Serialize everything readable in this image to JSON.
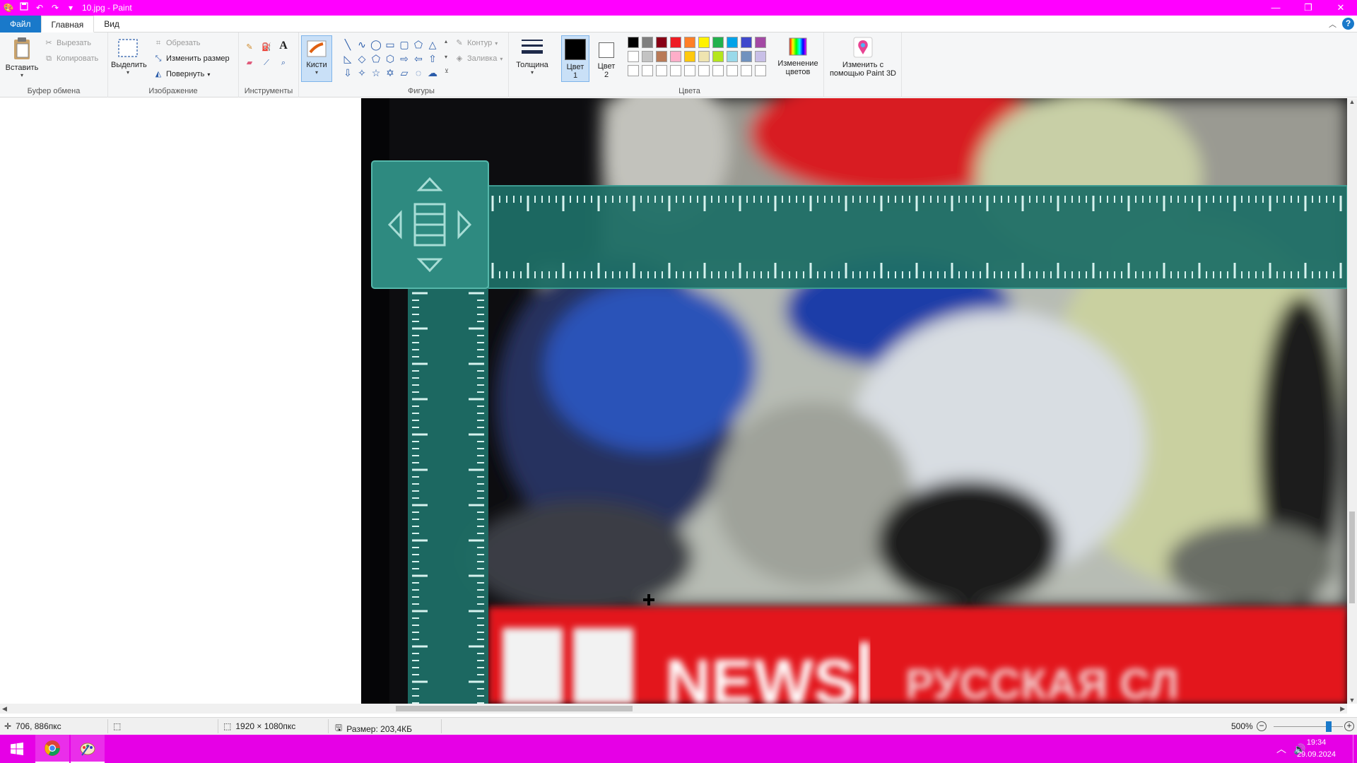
{
  "window": {
    "title": "10.jpg - Paint",
    "qa_icons": [
      "paint-app-icon",
      "save-icon",
      "undo-icon",
      "redo-icon",
      "customize-dropdown-icon"
    ],
    "controls": [
      "minimize",
      "restore",
      "close"
    ]
  },
  "menu": {
    "file": "Файл",
    "home": "Главная",
    "view": "Вид"
  },
  "ribbon": {
    "clipboard": {
      "label": "Буфер обмена",
      "paste": "Вставить",
      "cut": "Вырезать",
      "copy": "Копировать"
    },
    "image": {
      "label": "Изображение",
      "select": "Выделить",
      "crop": "Обрезать",
      "resize": "Изменить размер",
      "rotate": "Повернуть"
    },
    "tools": {
      "label": "Инструменты",
      "brushes": "Кисти"
    },
    "shapes": {
      "label": "Фигуры",
      "outline": "Контур",
      "fill": "Заливка"
    },
    "thickness": "Толщина",
    "colors": {
      "label": "Цвета",
      "color1_line1": "Цвет",
      "color1_line2": "1",
      "color2_line1": "Цвет",
      "color2_line2": "2",
      "color1_value": "#000000",
      "color2_value": "#ffffff",
      "edit_line1": "Изменение",
      "edit_line2": "цветов",
      "palette_row1": [
        "#000000",
        "#7f7f7f",
        "#880015",
        "#ed1c24",
        "#ff7f27",
        "#fff200",
        "#22b14c",
        "#00a2e8",
        "#3f48cc",
        "#a349a4"
      ],
      "palette_row2": [
        "#ffffff",
        "#c3c3c3",
        "#b97a57",
        "#ffaec9",
        "#ffc90e",
        "#efe4b0",
        "#b5e61d",
        "#99d9ea",
        "#7092be",
        "#c8bfe7"
      ],
      "palette_row3": [
        "#ffffff",
        "#ffffff",
        "#ffffff",
        "#ffffff",
        "#ffffff",
        "#ffffff",
        "#ffffff",
        "#ffffff",
        "#ffffff",
        "#ffffff"
      ]
    },
    "paint3d_line1": "Изменить с",
    "paint3d_line2": "помощью Paint 3D"
  },
  "canvas": {
    "banner_text": "NEWS",
    "banner_text_2": "РУССКАЯ СЛ"
  },
  "status": {
    "cursor_pos": "706, 886пкс",
    "image_size": "1920 × 1080пкс",
    "file_size": "Размер: 203,4КБ",
    "zoom": "500%",
    "zoom_fraction": 0.8
  },
  "taskbar": {
    "time": "19:34",
    "date": "29.09.2024"
  }
}
